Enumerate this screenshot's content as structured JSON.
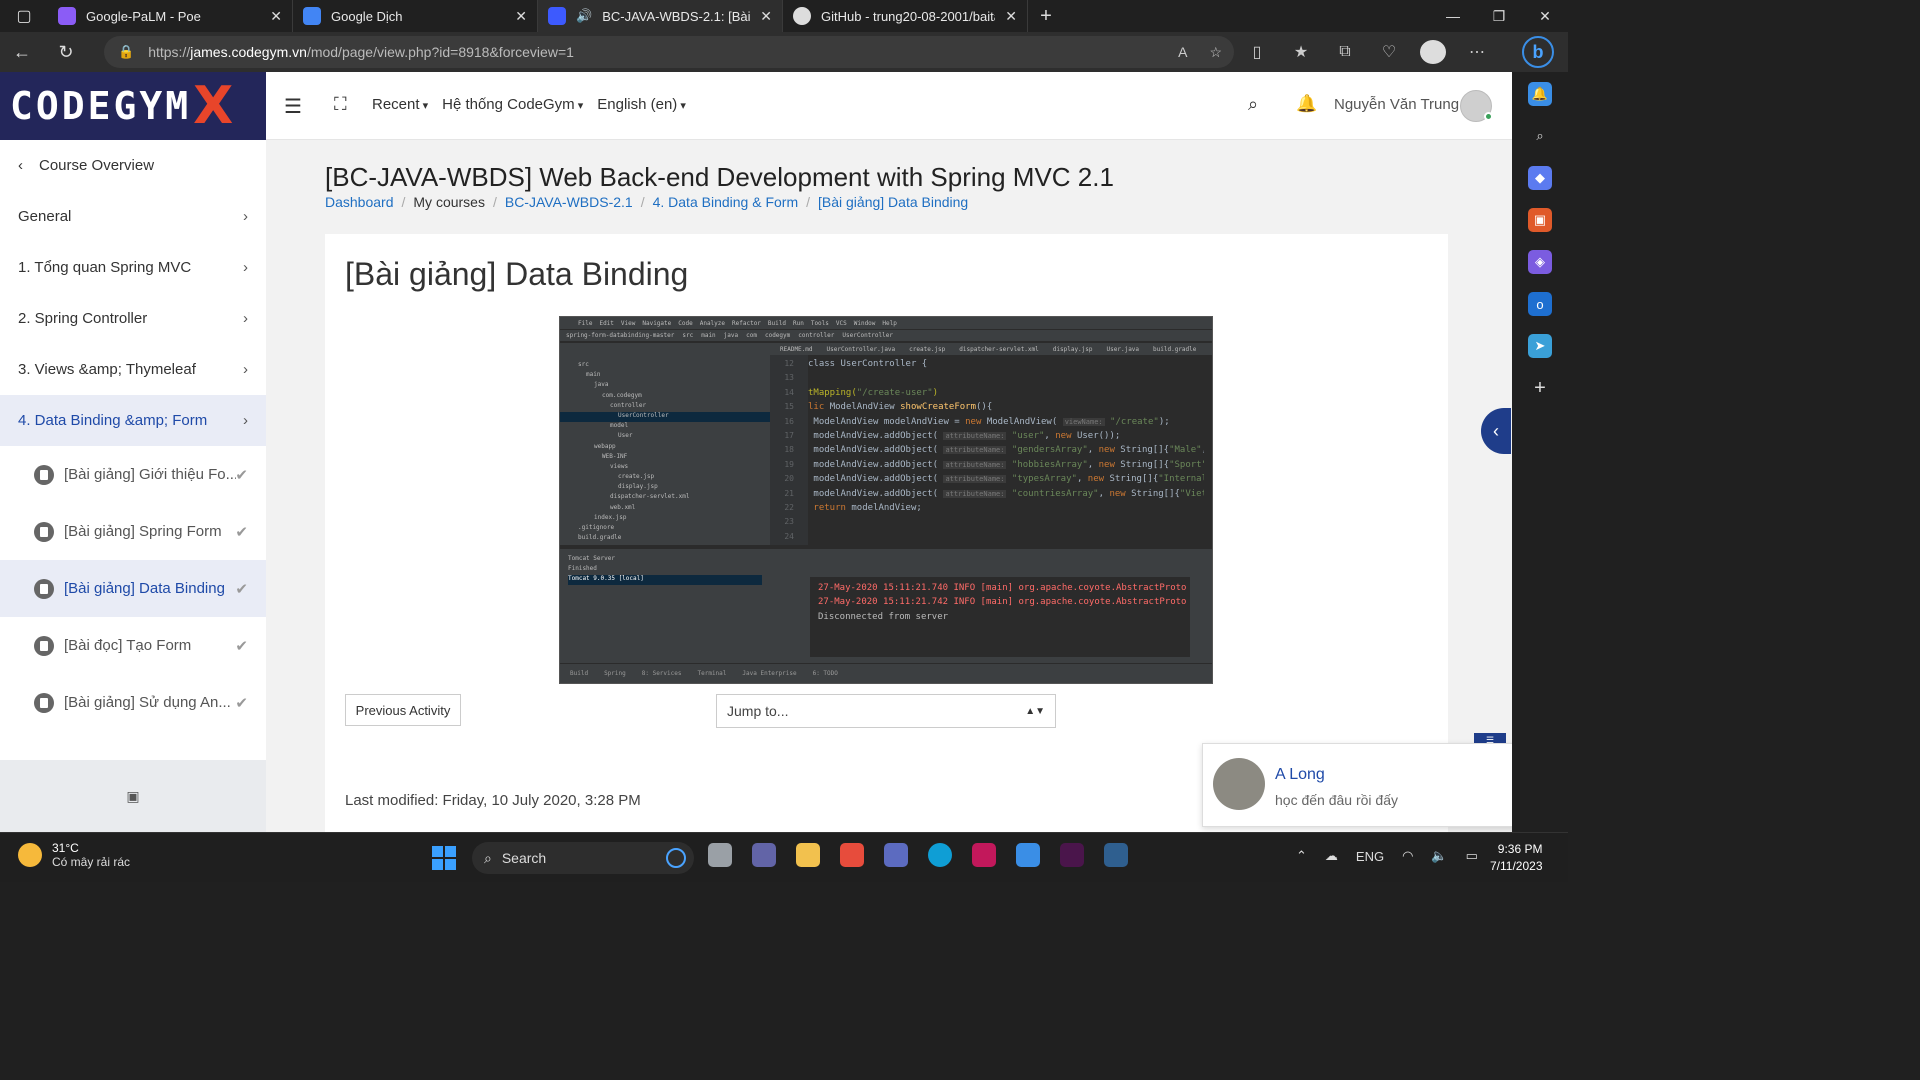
{
  "browser": {
    "tabs": [
      {
        "title": "Google-PaLM - Poe",
        "color": "#8b5cf6",
        "active": false
      },
      {
        "title": "Google Dịch",
        "color": "#4285f4",
        "active": false
      },
      {
        "title": "BC-JAVA-WBDS-2.1: [Bài giả",
        "color": "#3d5afe",
        "active": true
      },
      {
        "title": "GitHub - trung20-08-2001/baita",
        "color": "#dddddd",
        "active": false
      }
    ],
    "url_prefix": "https://",
    "url_host": "james.codegym.vn",
    "url_path": "/mod/page/view.php?id=8918&forceview=1"
  },
  "header": {
    "logo_text": "CODEGYM",
    "logo_x": "X",
    "nav": [
      "Recent",
      "Hệ thống CodeGym",
      "English (en)"
    ],
    "user_name": "Nguyễn Văn Trung"
  },
  "sidebar": {
    "back_label": "Course Overview",
    "sections": [
      {
        "label": "General",
        "active": false
      },
      {
        "label": "1. Tổng quan Spring MVC",
        "active": false
      },
      {
        "label": "2. Spring Controller",
        "active": false
      },
      {
        "label": "3. Views &amp; Thymeleaf",
        "active": false
      },
      {
        "label": "4. Data Binding &amp; Form",
        "active": true
      }
    ],
    "activities": [
      {
        "label": "[Bài giảng] Giới thiệu Fo...",
        "active": false
      },
      {
        "label": "[Bài giảng] Spring Form",
        "active": false
      },
      {
        "label": "[Bài giảng] Data Binding",
        "active": true
      },
      {
        "label": "[Bài đọc] Tạo Form",
        "active": false
      },
      {
        "label": "[Bài giảng] Sử dụng An...",
        "active": false
      }
    ]
  },
  "main": {
    "course_title": "[BC-JAVA-WBDS] Web Back-end Development with Spring MVC 2.1",
    "breadcrumb": [
      "Dashboard",
      "My courses",
      "BC-JAVA-WBDS-2.1",
      "4. Data Binding & Form",
      "[Bài giảng] Data Binding"
    ],
    "page_title": "[Bài giảng] Data Binding",
    "last_modified": "Last modified: Friday, 10 July 2020, 3:28 PM",
    "prev_button": "Previous Activity",
    "jump_placeholder": "Jump to..."
  },
  "ide": {
    "menu": [
      "File",
      "Edit",
      "View",
      "Navigate",
      "Code",
      "Analyze",
      "Refactor",
      "Build",
      "Run",
      "Tools",
      "VCS",
      "Window",
      "Help"
    ],
    "crumbs": [
      "spring-form-databinding-master",
      "src",
      "main",
      "java",
      "com",
      "codegym",
      "controller",
      "UserController"
    ],
    "project_tree": [
      "src",
      "main",
      "java",
      "com.codegym",
      "controller",
      "UserController",
      "model",
      "User",
      "webapp",
      "WEB-INF",
      "views",
      "create.jsp",
      "display.jsp",
      "dispatcher-servlet.xml",
      "web.xml",
      "index.jsp",
      ".gitignore",
      "build.gradle"
    ],
    "editor_tabs": [
      "README.md",
      "UserController.java",
      "create.jsp",
      "dispatcher-servlet.xml",
      "display.jsp",
      "User.java",
      "build.gradle"
    ],
    "line_numbers": [
      "12",
      "13",
      "14",
      "15",
      "16",
      "17",
      "18",
      "19",
      "20",
      "21",
      "22",
      "23",
      "24"
    ],
    "log_lines": [
      "27-May-2020 15:11:21.740 INFO [main] org.apache.coyote.AbstractProto",
      "27-May-2020 15:11:21.742 INFO [main] org.apache.coyote.AbstractProto"
    ],
    "log_plain": "Disconnected from server",
    "services": [
      "Tomcat Server",
      "Finished",
      "Tomcat 9.0.35 [local]"
    ],
    "status": [
      "Build",
      "Spring",
      "8: Services",
      "Terminal",
      "Java Enterprise",
      "6: TODO"
    ]
  },
  "chat": {
    "name": "A Long",
    "message": "học đến đâu rồi đấy"
  },
  "taskbar": {
    "temperature": "31°C",
    "weather": "Có mây rải rác",
    "search": "Search",
    "lang": "ENG",
    "time": "9:36 PM",
    "date": "7/11/2023"
  }
}
